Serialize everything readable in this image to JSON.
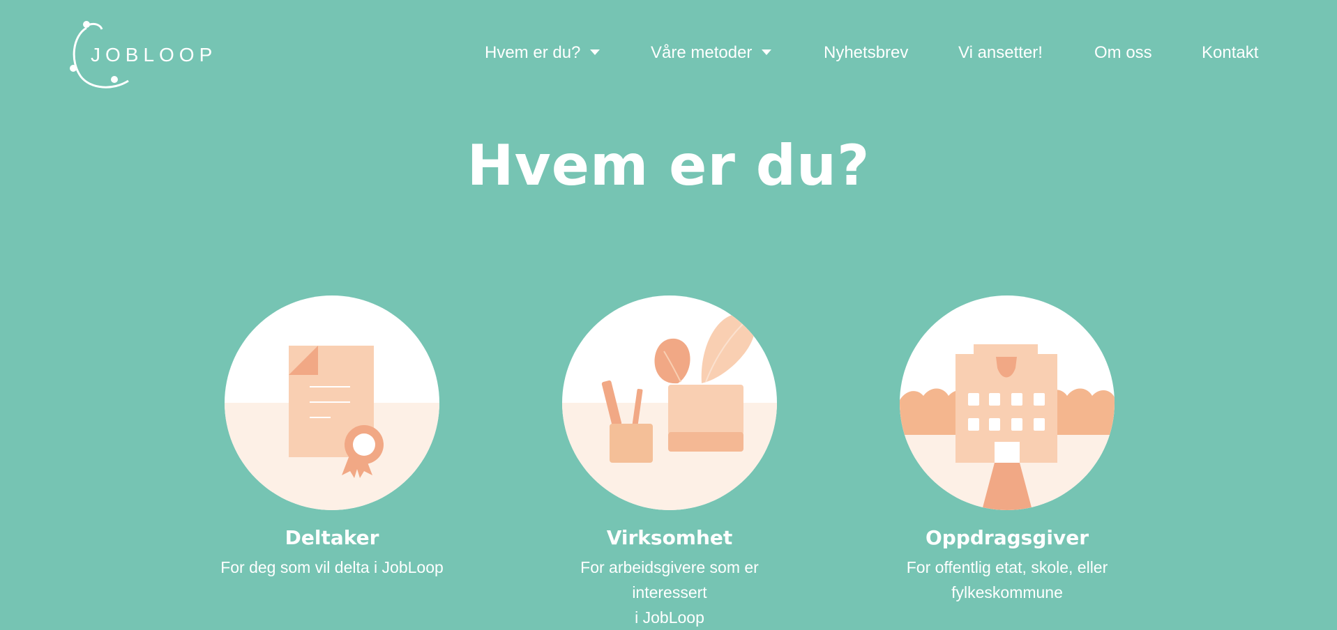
{
  "brand": {
    "name": "JOBLOOP"
  },
  "nav": {
    "items": [
      {
        "label": "Hvem er du?",
        "dropdown": true
      },
      {
        "label": "Våre metoder",
        "dropdown": true
      },
      {
        "label": "Nyhetsbrev",
        "dropdown": false
      },
      {
        "label": "Vi ansetter!",
        "dropdown": false
      },
      {
        "label": "Om oss",
        "dropdown": false
      },
      {
        "label": "Kontakt",
        "dropdown": false
      }
    ]
  },
  "main": {
    "title": "Hvem er du?",
    "cards": [
      {
        "title": "Deltaker",
        "desc_line1": "For deg som vil delta i JobLoop",
        "desc_line2": "",
        "icon": "certificate-icon"
      },
      {
        "title": "Virksomhet",
        "desc_line1": "For arbeidsgivere som er interessert",
        "desc_line2": "i JobLoop",
        "icon": "office-plant-icon"
      },
      {
        "title": "Oppdragsgiver",
        "desc_line1": "For offentlig etat, skole, eller",
        "desc_line2": "fylkeskommune",
        "icon": "building-icon"
      }
    ]
  },
  "colors": {
    "background": "#76c4b3",
    "accent_peach": "#f9cfb2",
    "accent_orange": "#f1a885",
    "light_peach": "#fdf0e6"
  }
}
